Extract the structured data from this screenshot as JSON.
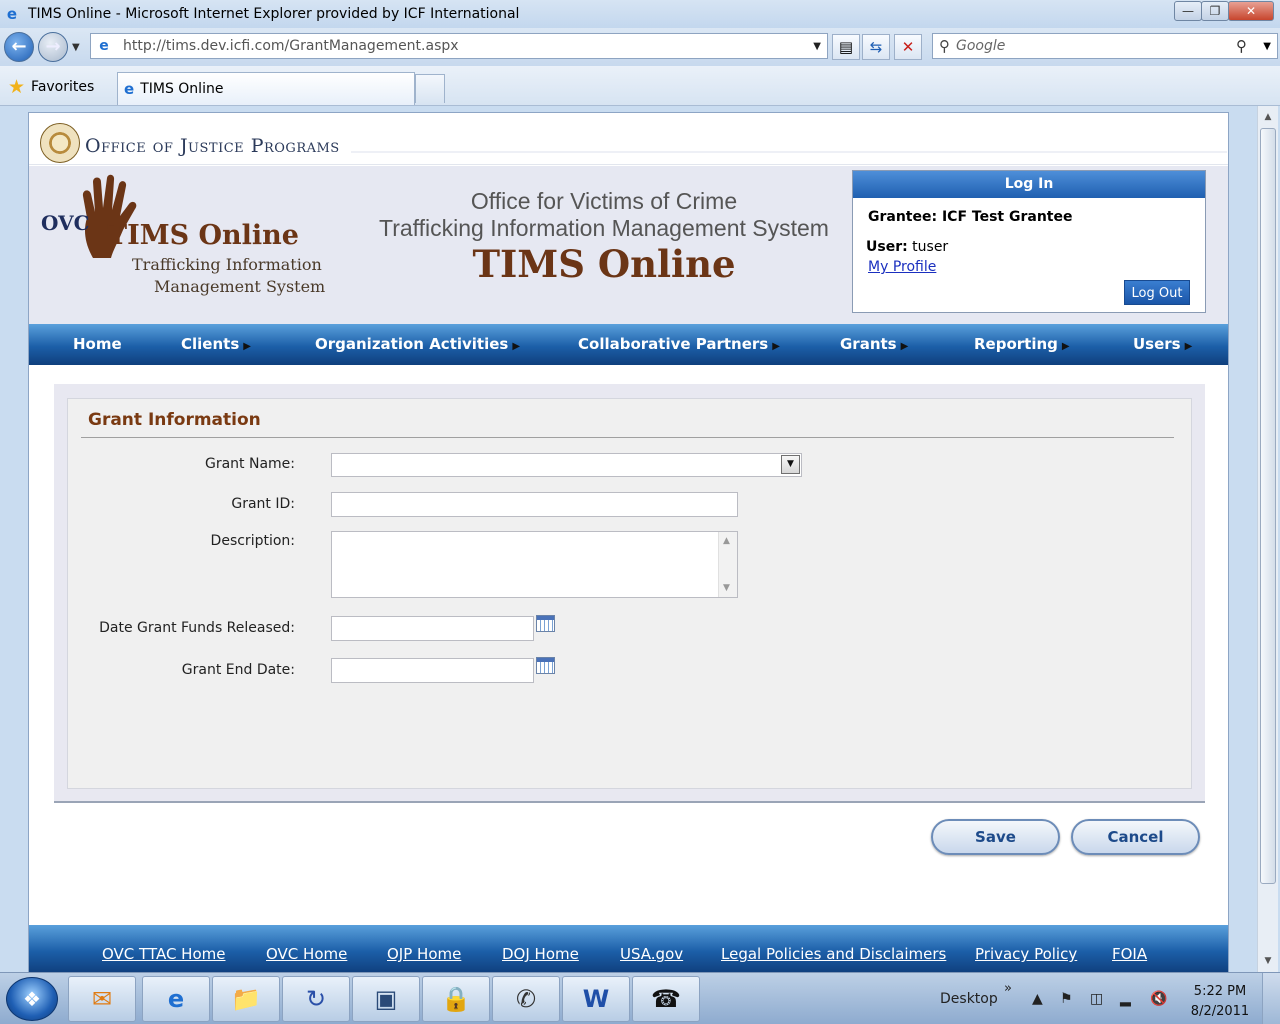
{
  "window": {
    "title": "TIMS Online - Microsoft Internet Explorer provided by ICF International",
    "minimize": "—",
    "restore": "❐",
    "close": "✕"
  },
  "browser": {
    "url": "http://tims.dev.icfi.com/GrantManagement.aspx",
    "search_placeholder": "Google",
    "favorites_label": "Favorites",
    "tab_title": "TIMS Online"
  },
  "page": {
    "agency": "Office of Justice Programs",
    "logo": {
      "ovc": "OVC",
      "name": "TIMS Online",
      "sub1": "Trafficking Information",
      "sub2": "Management System"
    },
    "header": {
      "line1": "Office for Victims of Crime",
      "line2": "Trafficking Information Management System",
      "line3": "TIMS Online"
    },
    "login": {
      "heading": "Log In",
      "grantee": "Grantee: ICF Test Grantee",
      "user_label": "User:",
      "user_value": "tuser",
      "profile_link": "My Profile",
      "logout_button": "Log Out"
    },
    "nav": [
      {
        "label": "Home"
      },
      {
        "label": "Clients"
      },
      {
        "label": "Organization Activities"
      },
      {
        "label": "Collaborative Partners"
      },
      {
        "label": "Grants"
      },
      {
        "label": "Reporting"
      },
      {
        "label": "Users"
      }
    ],
    "form": {
      "title": "Grant Information",
      "grant_name_label": "Grant Name:",
      "grant_name_value": "",
      "grant_id_label": "Grant ID:",
      "grant_id_value": "",
      "description_label": "Description:",
      "description_value": "",
      "date_released_label": "Date Grant Funds Released:",
      "date_released_value": "",
      "end_date_label": "Grant End Date:",
      "end_date_value": ""
    },
    "buttons": {
      "save": "Save",
      "cancel": "Cancel"
    },
    "footer_links": [
      "OVC TTAC Home",
      "OVC Home",
      "OJP Home",
      "DOJ Home",
      "USA.gov",
      "Legal Policies and Disclaimers",
      "Privacy Policy",
      "FOIA"
    ]
  },
  "taskbar": {
    "desktop_label": "Desktop",
    "time": "5:22 PM",
    "date": "8/2/2011"
  }
}
